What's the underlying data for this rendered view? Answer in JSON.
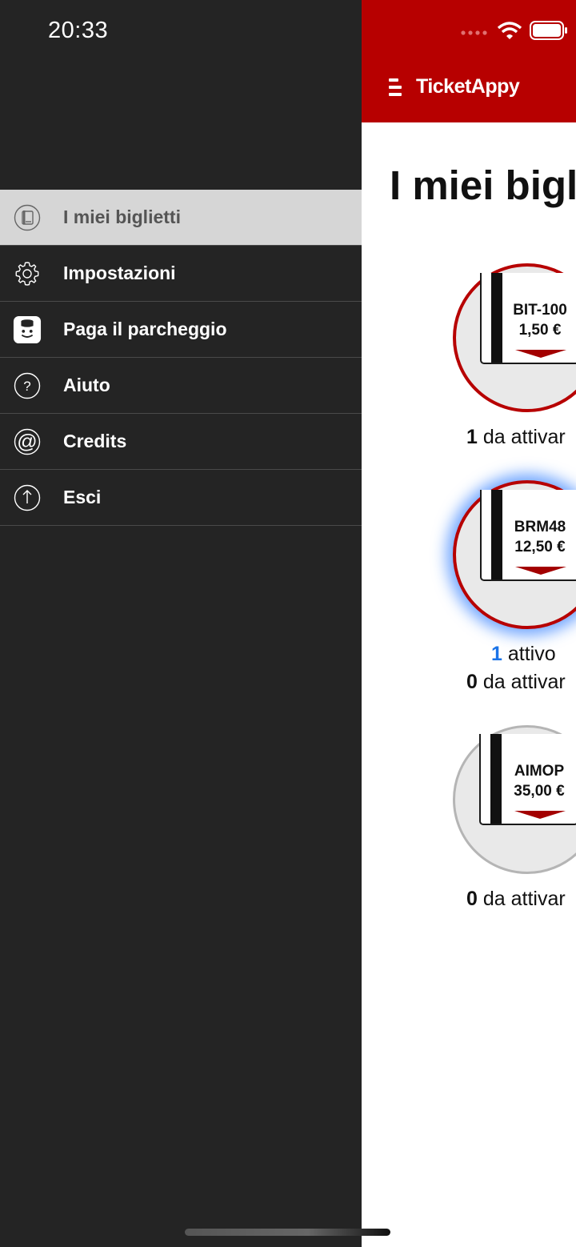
{
  "status_bar": {
    "time": "20:33"
  },
  "drawer": {
    "items": [
      {
        "label": "I miei biglietti",
        "icon": "tickets-icon",
        "active": true
      },
      {
        "label": "Impostazioni",
        "icon": "gear-icon",
        "active": false
      },
      {
        "label": "Paga il parcheggio",
        "icon": "parking-app-icon",
        "active": false
      },
      {
        "label": "Aiuto",
        "icon": "help-icon",
        "active": false
      },
      {
        "label": "Credits",
        "icon": "at-icon",
        "active": false
      },
      {
        "label": "Esci",
        "icon": "logout-icon",
        "active": false
      }
    ]
  },
  "header": {
    "app_name": "TicketAppy",
    "menu_icon": "hamburger-icon",
    "color": "#b70000"
  },
  "main": {
    "title": "I miei bigl",
    "tickets": [
      {
        "code": "BIT-100",
        "price": "1,50 €",
        "ring": "red",
        "glow": false,
        "counts": [
          {
            "num": "1",
            "text": " da attivar",
            "blue": false
          }
        ]
      },
      {
        "code": "BRM48",
        "price": "12,50 €",
        "ring": "red",
        "glow": true,
        "counts": [
          {
            "num": "1",
            "text": " attivo",
            "blue": true
          },
          {
            "num": "0",
            "text": " da attivar",
            "blue": false
          }
        ]
      },
      {
        "code": "AIMOP",
        "price": "35,00 €",
        "ring": "grey",
        "glow": false,
        "counts": [
          {
            "num": "0",
            "text": " da attivar",
            "blue": false
          }
        ]
      }
    ]
  },
  "colors": {
    "drawer_bg": "#242424",
    "active_item_bg": "#d6d6d6",
    "accent_red": "#b70000",
    "active_blue": "#1a73e8"
  }
}
